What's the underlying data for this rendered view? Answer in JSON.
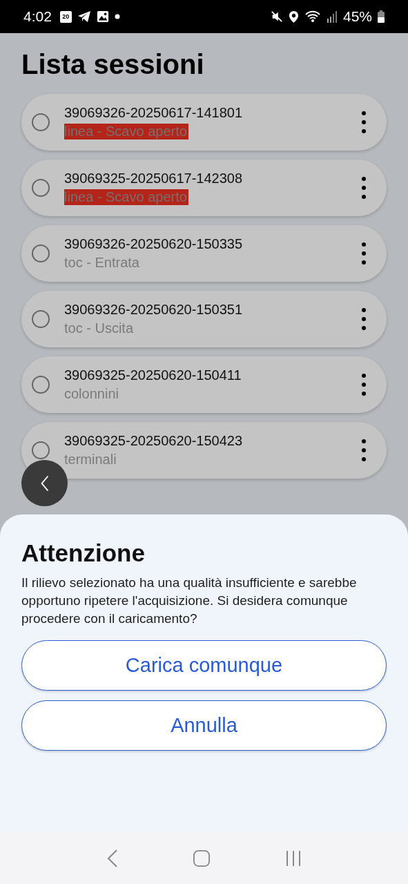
{
  "status_bar": {
    "time": "4:02",
    "calendar_day": "20",
    "battery": "45%"
  },
  "title": "Lista sessioni",
  "sessions": [
    {
      "id": "39069326-20250617-141801",
      "subtitle": "linea - Scavo aperto",
      "flagged": true,
      "selected": false
    },
    {
      "id": "39069325-20250617-142308",
      "subtitle": "linea - Scavo aperto",
      "flagged": true,
      "selected": false
    },
    {
      "id": "39069326-20250620-150335",
      "subtitle": "toc - Entrata",
      "flagged": false,
      "selected": false
    },
    {
      "id": "39069326-20250620-150351",
      "subtitle": "toc - Uscita",
      "flagged": false,
      "selected": false
    },
    {
      "id": "39069325-20250620-150411",
      "subtitle": "colonnini",
      "flagged": false,
      "selected": false
    },
    {
      "id": "39069325-20250620-150423",
      "subtitle": "terminali",
      "flagged": false,
      "selected": false
    }
  ],
  "dialog": {
    "title": "Attenzione",
    "message": "Il rilievo selezionato ha una qualità insufficiente e sarebbe opportuno ripetere l'acquisizione. Si desidera comunque procedere con il caricamento?",
    "buttons": [
      "Carica comunque",
      "Annulla"
    ]
  }
}
